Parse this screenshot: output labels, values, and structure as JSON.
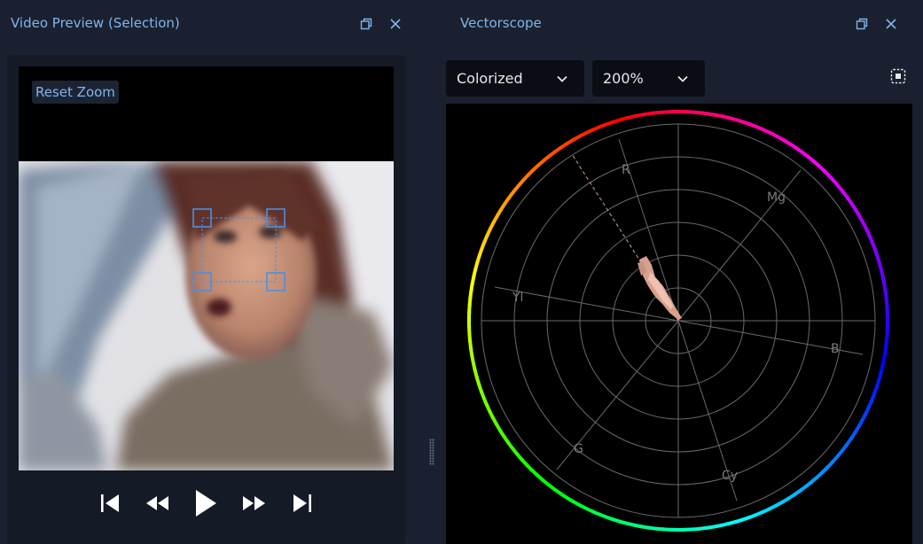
{
  "left_panel": {
    "title": "Video Preview (Selection)",
    "reset_zoom_label": "Reset Zoom",
    "controls": [
      "restore-icon",
      "close-icon"
    ],
    "transport": [
      "skip-to-start-icon",
      "rewind-icon",
      "play-icon",
      "fast-forward-icon",
      "skip-to-end-icon"
    ]
  },
  "right_panel": {
    "title": "Vectorscope",
    "mode_dropdown": {
      "value": "Colorized"
    },
    "zoom_dropdown": {
      "value": "200%"
    },
    "controls": [
      "restore-icon",
      "close-icon",
      "focus-selection-icon"
    ],
    "vectorscope": {
      "target_labels": {
        "r": "R",
        "mg": "Mg",
        "yl": "Yl",
        "b": "B",
        "g": "G",
        "cy": "Cy"
      }
    }
  },
  "colors": {
    "accent": "#7fb4ee",
    "background": "#1a2030",
    "selection_handle": "#4a90e2"
  }
}
